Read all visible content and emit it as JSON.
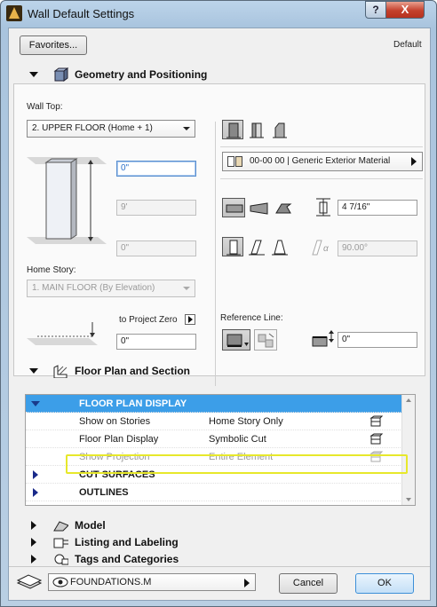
{
  "window": {
    "title": "Wall Default Settings",
    "help_label": "?",
    "close_label": "X"
  },
  "top": {
    "favorites_label": "Favorites...",
    "default_label": "Default"
  },
  "geometry": {
    "title": "Geometry and Positioning",
    "wall_top_label": "Wall Top:",
    "wall_top_value": "2. UPPER FLOOR (Home + 1)",
    "top_offset": "0\"",
    "height_value": "9'",
    "bottom_offset": "0\"",
    "home_story_label": "Home Story:",
    "home_story_value": "1. MAIN FLOOR (By Elevation)",
    "to_project_zero_label": "to Project Zero",
    "project_zero_value": "0\"",
    "material_value": "00-00 00 | Generic Exterior Material",
    "thickness_value": "4 7/16\"",
    "angle_symbol": "α",
    "angle_value": "90.00°",
    "reference_line_label": "Reference Line:",
    "reference_offset": "0\""
  },
  "floor_plan": {
    "title": "Floor Plan and Section",
    "rows": [
      {
        "name": "FLOOR PLAN DISPLAY",
        "value": "",
        "kind": "header"
      },
      {
        "name": "Show on Stories",
        "value": "Home Story Only",
        "kind": "item"
      },
      {
        "name": "Floor Plan Display",
        "value": "Symbolic Cut",
        "kind": "item"
      },
      {
        "name": "Show Projection",
        "value": "Entire Element",
        "kind": "disabled"
      },
      {
        "name": "CUT SURFACES",
        "value": "",
        "kind": "group"
      },
      {
        "name": "OUTLINES",
        "value": "",
        "kind": "group"
      }
    ]
  },
  "collapsed_sections": {
    "model": "Model",
    "listing": "Listing and Labeling",
    "tags": "Tags and Categories"
  },
  "footer": {
    "layer_value": "FOUNDATIONS.M",
    "cancel_label": "Cancel",
    "ok_label": "OK"
  },
  "colors": {
    "header_row": "#3c9ee8",
    "highlight": "#e7e82b",
    "ok_border": "#3c8fd8"
  }
}
